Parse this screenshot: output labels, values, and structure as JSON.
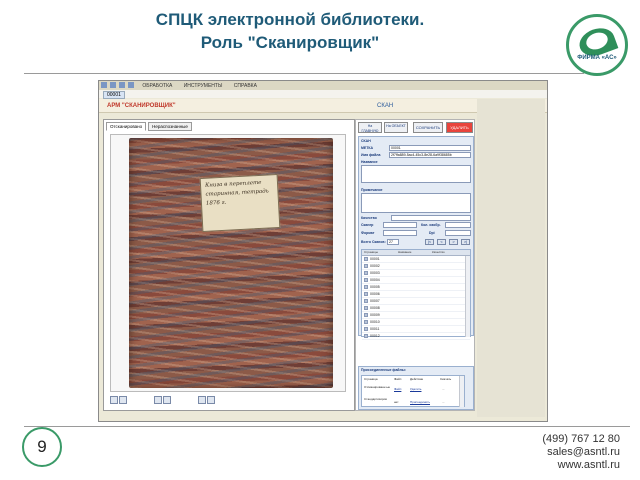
{
  "slide": {
    "title_line1": "СПЦК электронной библиотеки.",
    "title_line2": "Роль \"Сканировщик\"",
    "page_number": "9",
    "logo_caption": "ФИРМА «АС»",
    "contacts": {
      "phone": "(499) 767 12 80",
      "email": "sales@asntl.ru",
      "website": "www.asntl.ru"
    }
  },
  "app": {
    "menu": [
      "ОБРАБОТКА",
      "ИНСТРУМЕНТЫ",
      "СПРАВКА"
    ],
    "tab": "00001",
    "header_left": "АРМ \"СКАНИРОВЩИК\"",
    "header_right": "СКАН",
    "subtabs": [
      "Отсканировано",
      "Нераспознанные"
    ],
    "document_label": "Книга в переплете старинная, тетрадь 1876 г."
  },
  "buttons": {
    "to_main": "На ГЛАВНУЮ",
    "to_object": "На ОБЪЕКТ",
    "save": "СОХРАНИТЬ",
    "delete": "УДАЛИТЬ"
  },
  "form": {
    "section": "СКАН",
    "label_mark": "МЕТКА",
    "mark_value": "00001",
    "label_filename": "Имя файла",
    "filename_value": "2f7ffa889-5ac4-45c3-8e28-6a9f38685b",
    "label_title": "Название",
    "label_note": "Примечание",
    "label_quality": "Качество",
    "label_scanner": "Сканер",
    "label_image_count": "Кол. изобр.",
    "label_format": "Формат",
    "label_dpi": "Dpi",
    "label_total_scans": "Всего Сканов:",
    "total_scans_value": "27",
    "nav_first": "|<",
    "nav_prev": "<",
    "nav_next": ">",
    "nav_last": ">|"
  },
  "scan_table": {
    "headers": [
      "Страницы",
      "Название",
      "Качество"
    ],
    "rows": [
      "00001",
      "00002",
      "00003",
      "00004",
      "00005",
      "00006",
      "00007",
      "00008",
      "00009",
      "00010",
      "00011",
      "00012"
    ]
  },
  "attached": {
    "title": "Присоединенные файлы:",
    "headers": [
      "Страница",
      "Файл",
      "Действие",
      "Скачать"
    ],
    "rows": [
      {
        "page": "Отсканированн ые",
        "file": "Файл",
        "action": "Удалить",
        "download": "..."
      },
      {
        "page": "Стандартизиров",
        "file": "нет",
        "action": "Присоединить",
        "download": "..."
      }
    ]
  },
  "colors": {
    "title": "#1f5b78",
    "accent_green": "#3a9a68",
    "delete_button": "#e8443c",
    "header_text": "#c0392b"
  },
  "icons": [
    "save-icon",
    "print-icon",
    "rotate-left-icon",
    "rotate-right-icon",
    "zoom-in-icon",
    "zoom-out-icon"
  ]
}
